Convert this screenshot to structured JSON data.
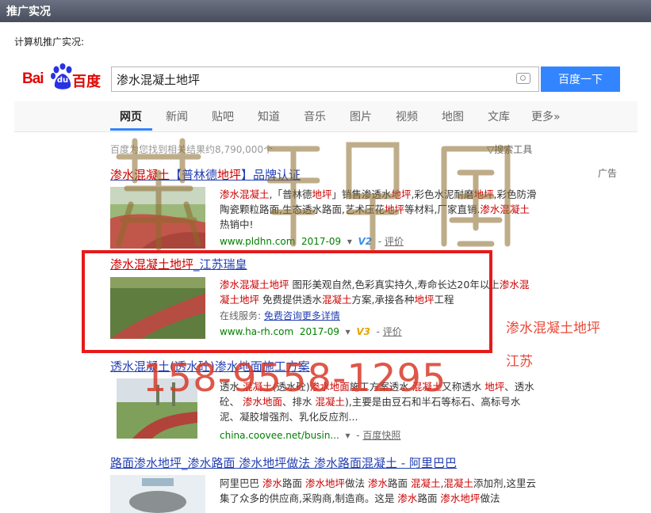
{
  "panel": {
    "title": "推广实况",
    "caption": "计算机推广实况:"
  },
  "logo": {
    "latin": "Bai",
    "badge": "du",
    "cn": "百度"
  },
  "search": {
    "query": "渗水混凝土地坪",
    "button": "百度一下"
  },
  "nav": [
    "网页",
    "新闻",
    "贴吧",
    "知道",
    "音乐",
    "图片",
    "视频",
    "地图",
    "文库",
    "更多»"
  ],
  "meta": {
    "count": "百度为您找到相关结果约8,790,000个",
    "tools": "搜索工具",
    "ad": "广告"
  },
  "results": [
    {
      "title_a": "渗水混凝土",
      "title_b": "【普林德",
      "title_c": "地坪",
      "title_d": "】品牌认证",
      "desc": [
        {
          "t": "渗水混凝土",
          "e": true
        },
        {
          "t": ",「普林德",
          "e": false
        },
        {
          "t": "地坪",
          "e": true
        },
        {
          "t": "」销售渗透水",
          "e": false
        },
        {
          "t": "地坪",
          "e": true
        },
        {
          "t": ",彩色水泥耐磨",
          "e": false
        },
        {
          "t": "地坪",
          "e": true
        },
        {
          "t": ",彩色防滑陶瓷颗粒路面,生态透水路面,艺术压花",
          "e": false
        },
        {
          "t": "地坪",
          "e": true
        },
        {
          "t": "等材料,厂家直销.",
          "e": false
        },
        {
          "t": "渗水混凝土",
          "e": true
        },
        {
          "t": "热销中!",
          "e": false
        }
      ],
      "url": "www.pldhn.com",
      "date": "2017-09",
      "vlabel": "V2",
      "eval": "评价"
    },
    {
      "title_a": "渗水混凝土地坪",
      "title_b": "_江苏瑞皇",
      "desc": [
        {
          "t": "渗水混凝土地坪",
          "e": true
        },
        {
          "t": " 图形美观自然,色彩真实持久,寿命长达20年以上",
          "e": false
        },
        {
          "t": "渗水混凝土地坪",
          "e": true
        },
        {
          "t": " 免费提供透水",
          "e": false
        },
        {
          "t": "混凝土",
          "e": true
        },
        {
          "t": "方案,承接各种",
          "e": false
        },
        {
          "t": "地坪",
          "e": true
        },
        {
          "t": "工程",
          "e": false
        }
      ],
      "svc_label": "在线服务:",
      "svc_link": "免费咨询更多详情",
      "url": "www.ha-rh.com",
      "date": "2017-09",
      "vlabel": "V3",
      "eval": "评价"
    },
    {
      "title": "透水混凝土(透水砼)渗水地面施工方案",
      "desc": [
        {
          "t": "透水 ",
          "e": false
        },
        {
          "t": "混凝土",
          "e": true
        },
        {
          "t": "(透水砼)",
          "e": false
        },
        {
          "t": "渗水地面",
          "e": true
        },
        {
          "t": "施工方案透水 ",
          "e": false
        },
        {
          "t": "混凝土",
          "e": true
        },
        {
          "t": "又称透水 ",
          "e": false
        },
        {
          "t": "地坪",
          "e": true
        },
        {
          "t": "、透水砼、 ",
          "e": false
        },
        {
          "t": "渗水地面",
          "e": true
        },
        {
          "t": "、排水 ",
          "e": false
        },
        {
          "t": "混凝土",
          "e": true
        },
        {
          "t": "),主要是由豆石和半石等标石、高标号水泥、凝胶增强剂、乳化反应剂...",
          "e": false
        }
      ],
      "url": "china.coovee.net/busin...",
      "snap": "百度快照"
    },
    {
      "title": "路面渗水地坪_渗水路面 渗水地坪做法 渗水路面混凝土 - 阿里巴巴",
      "desc": [
        {
          "t": "阿里巴巴 ",
          "e": false
        },
        {
          "t": "渗水",
          "e": true
        },
        {
          "t": "路面 ",
          "e": false
        },
        {
          "t": "渗水地坪",
          "e": true
        },
        {
          "t": "做法 ",
          "e": false
        },
        {
          "t": "渗水",
          "e": true
        },
        {
          "t": "路面 ",
          "e": false
        },
        {
          "t": "混凝土",
          "e": true
        },
        {
          "t": ",",
          "e": false
        },
        {
          "t": "混凝土",
          "e": true
        },
        {
          "t": "添加剂,这里云集了众多的供应商,采购商,制造商。这是 ",
          "e": false
        },
        {
          "t": "渗水",
          "e": true
        },
        {
          "t": "路面 ",
          "e": false
        },
        {
          "t": "渗水地坪",
          "e": true
        },
        {
          "t": "做法",
          "e": false
        }
      ]
    }
  ],
  "side": {
    "line1": "渗水混凝土地坪",
    "line2": "江苏"
  },
  "watermark": {
    "phone": "158-9558-1295"
  },
  "colors": {
    "accent": "#3385ff",
    "link": "#2440b3",
    "highlight": "#c00",
    "frame": "#e61a1a",
    "url": "#008000"
  }
}
